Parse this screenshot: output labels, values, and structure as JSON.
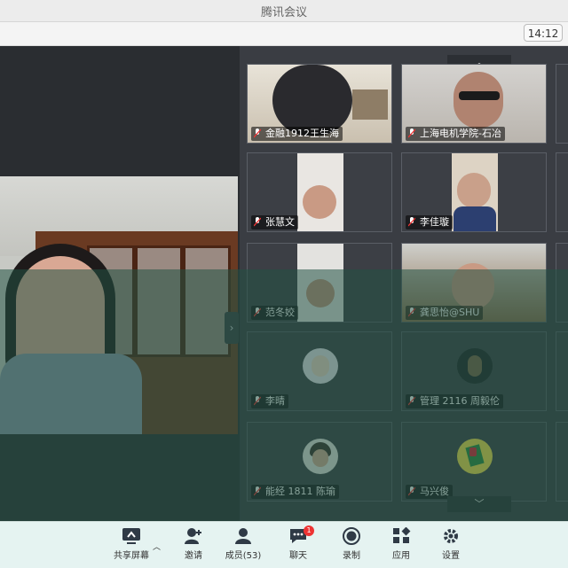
{
  "window": {
    "title": "腾讯会议"
  },
  "topbar": {
    "time": "14:12"
  },
  "main_video": {
    "participant": ""
  },
  "gallery": {
    "tiles": [
      {
        "name": "金融1912王生海",
        "type": "camera"
      },
      {
        "name": "上海电机学院-石冶",
        "type": "camera"
      },
      {
        "name": "张慧文",
        "type": "camera"
      },
      {
        "name": "李佳璇",
        "type": "camera"
      },
      {
        "name": "范冬姣",
        "type": "camera"
      },
      {
        "name": "龚思怡@SHU",
        "type": "camera"
      },
      {
        "name": "李晴",
        "type": "avatar"
      },
      {
        "name": "管理 2116 周毅伦",
        "type": "avatar"
      },
      {
        "name": "能经 1811 陈瑜",
        "type": "avatar"
      },
      {
        "name": "马兴俊",
        "type": "avatar"
      }
    ],
    "scroll_up_icon": "chevron-up-icon",
    "scroll_down_icon": "chevron-down-icon",
    "collapse_icon": "chevron-right-icon"
  },
  "toolbar": {
    "share_label": "共享屏幕",
    "invite_label": "邀请",
    "members_label": "成员(53)",
    "chat_label": "聊天",
    "chat_badge": "1",
    "record_label": "录制",
    "apps_label": "应用",
    "settings_label": "设置"
  },
  "colors": {
    "toolbar_bg": "#e5f3f1",
    "overlay_tint": "#225244",
    "badge_red": "#e33333"
  }
}
